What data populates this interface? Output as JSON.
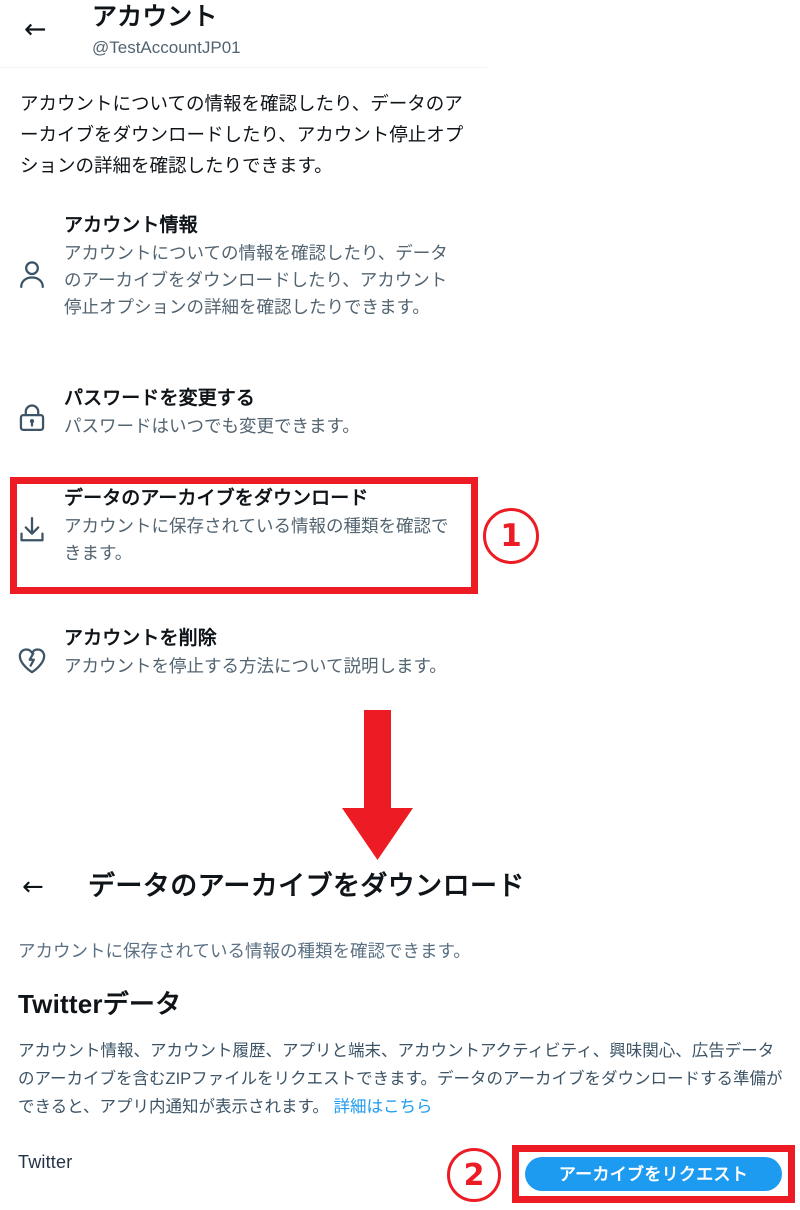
{
  "colors": {
    "accent_blue": "#1d9bf0",
    "annotation_red": "#ed1c24",
    "text_primary": "#0f1419",
    "text_secondary": "#536471"
  },
  "screen_one": {
    "back_icon": "back-arrow-icon",
    "title": "アカウント",
    "handle": "@TestAccountJP01",
    "intro": "アカウントについての情報を確認したり、データのアーカイブをダウンロードしたり、アカウント停止オプションの詳細を確認したりできます。",
    "items": [
      {
        "icon": "person-icon",
        "title": "アカウント情報",
        "desc": "アカウントについての情報を確認したり、データのアーカイブをダウンロードしたり、アカウント停止オプションの詳細を確認したりできます。"
      },
      {
        "icon": "lock-icon",
        "title": "パスワードを変更する",
        "desc": "パスワードはいつでも変更できます。"
      },
      {
        "icon": "download-icon",
        "title": "データのアーカイブをダウンロード",
        "desc": "アカウントに保存されている情報の種類を確認できます。"
      },
      {
        "icon": "broken-heart-icon",
        "title": "アカウントを削除",
        "desc": "アカウントを停止する方法について説明します。"
      }
    ]
  },
  "annotations": {
    "marker_one": "①",
    "marker_one_digit": "1",
    "marker_two": "②",
    "marker_two_digit": "2",
    "arrow": "down-arrow-annotation"
  },
  "screen_two": {
    "back_icon": "back-arrow-icon",
    "title": "データのアーカイブをダウンロード",
    "subtitle": "アカウントに保存されている情報の種類を確認できます。",
    "section_title": "Twitterデータ",
    "body": "アカウント情報、アカウント履歴、アプリと端末、アカウントアクティビティ、興味関心、広告データのアーカイブを含むZIPファイルをリクエストできます。データのアーカイブをダウンロードする準備ができると、アプリ内通知が表示されます。",
    "body_link": "詳細はこちら",
    "footer_brand": "Twitter",
    "request_button": "アーカイブをリクエスト"
  }
}
